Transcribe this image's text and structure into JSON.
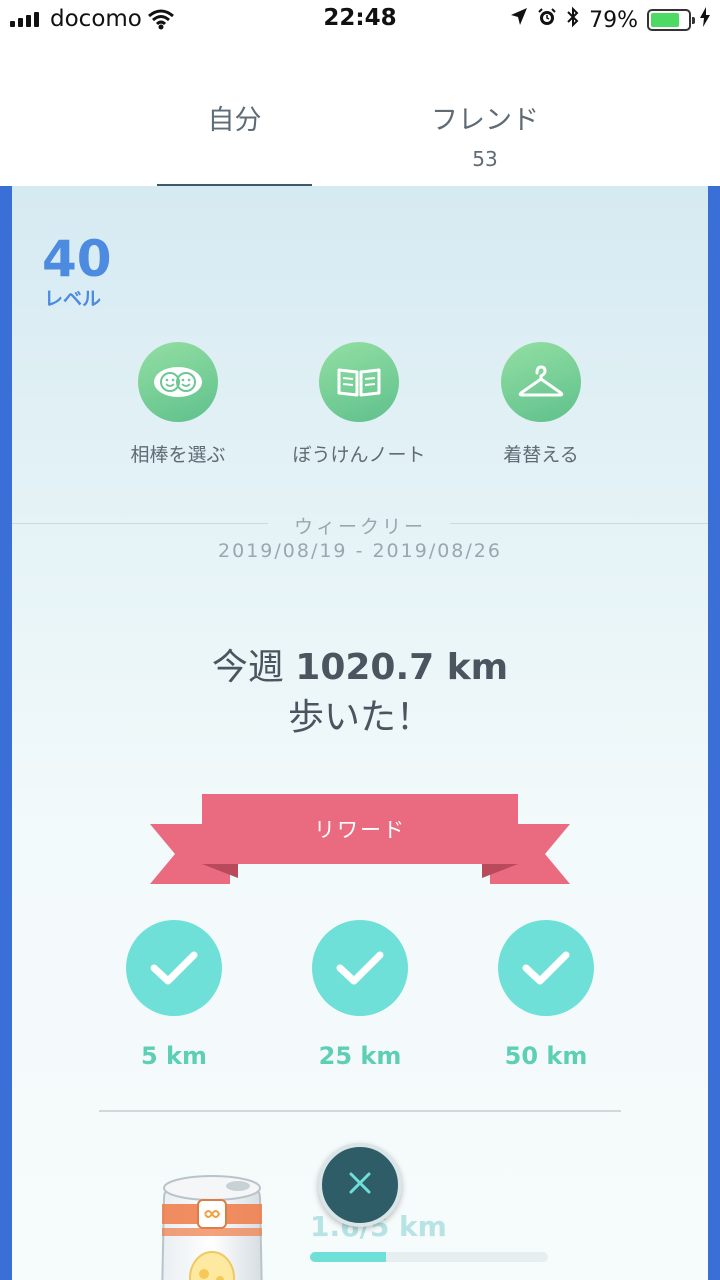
{
  "status_bar": {
    "carrier": "docomo",
    "time": "22:48",
    "battery_text": "79%",
    "battery_level": 0.79
  },
  "tabs": {
    "self_label": "自分",
    "friends_label": "フレンド",
    "friends_count": "53"
  },
  "profile": {
    "level_number": "40",
    "level_label": "レベル"
  },
  "actions": [
    {
      "label": "相棒を選ぶ",
      "icon": "buddy-icon"
    },
    {
      "label": "ぼうけんノート",
      "icon": "book-icon"
    },
    {
      "label": "着替える",
      "icon": "hanger-icon"
    }
  ],
  "weekly": {
    "title": "ウィークリー",
    "dates": "2019/08/19 - 2019/08/26",
    "walked_prefix": "今週 ",
    "walked_distance": "1020.7 km",
    "walked_suffix": "歩いた！",
    "reward_label": "リワード",
    "rewards": [
      {
        "km": "5 km",
        "achieved": true
      },
      {
        "km": "25 km",
        "achieved": true
      },
      {
        "km": "50 km",
        "achieved": true
      }
    ]
  },
  "egg": {
    "progress_text": "1.6/5 km",
    "progress_fraction": 0.32
  },
  "colors": {
    "accent_blue": "#4d8be0",
    "frame_blue": "#3b6fd8",
    "reward_pink": "#ea6a7f",
    "check_teal": "#6ee0d8",
    "km_green": "#5ccfb4"
  }
}
